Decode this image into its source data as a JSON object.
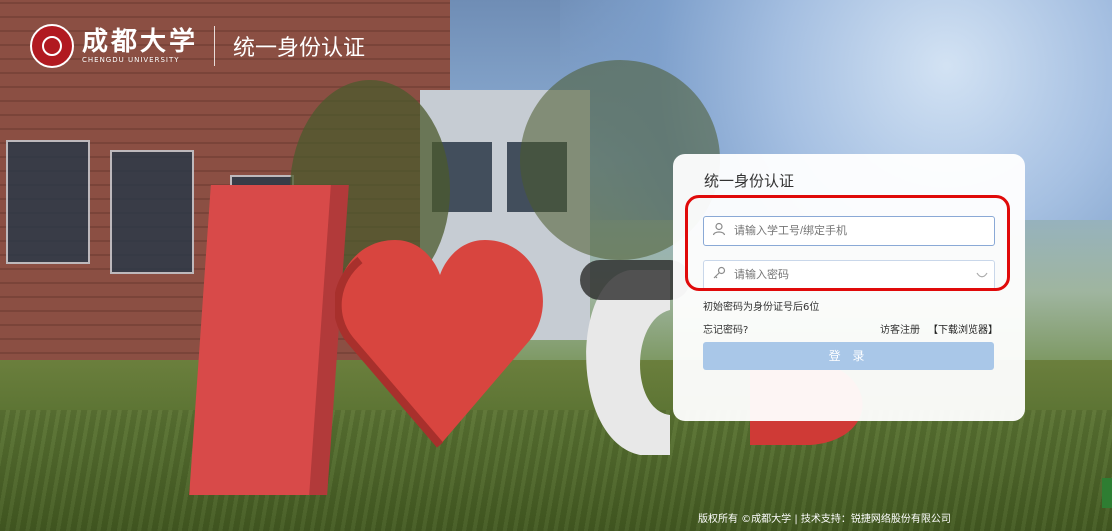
{
  "header": {
    "university_cn": "成都大学",
    "university_en": "CHENGDU UNIVERSITY",
    "system_title": "统一身份认证"
  },
  "login": {
    "title": "统一身份认证",
    "username_placeholder": "请输入学工号/绑定手机",
    "password_placeholder": "请输入密码",
    "hint": "初始密码为身份证号后6位",
    "forgot_label": "忘记密码?",
    "register_label": "访客注册",
    "download_label": "【下载浏览器】",
    "submit_label": "登 录"
  },
  "footer": {
    "text": "版权所有 ©成都大学 | 技术支持：锐捷网络股份有限公司"
  },
  "icons": {
    "user": "user-icon",
    "key": "key-icon",
    "eye": "eye-icon"
  },
  "colors": {
    "highlight": "#e00a0a",
    "button": "#a9c7e8",
    "brand_red": "#b11a20"
  }
}
